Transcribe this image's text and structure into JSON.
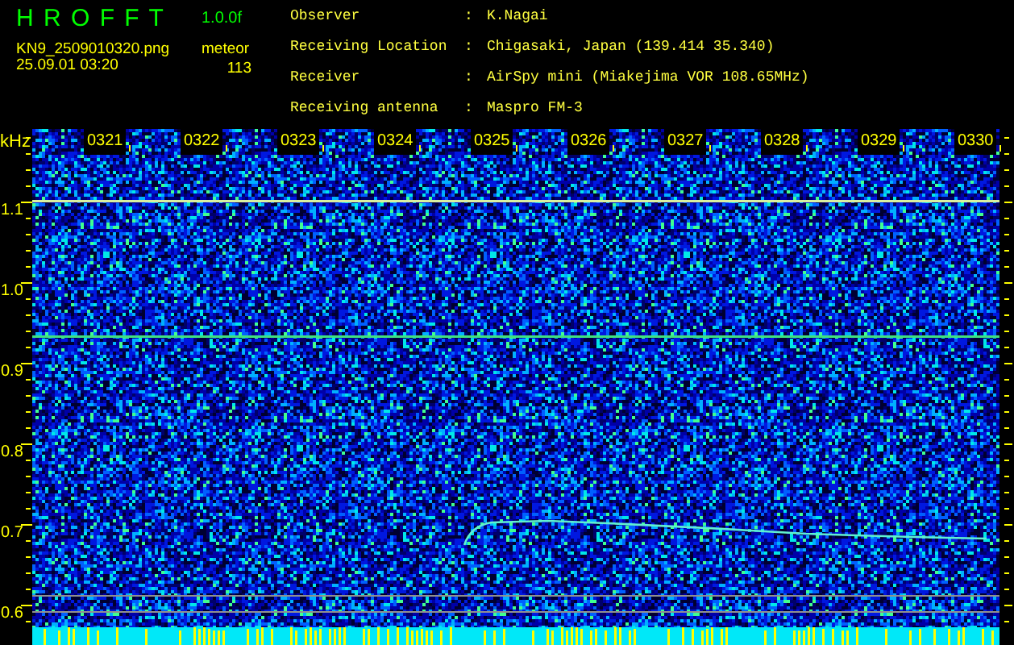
{
  "header": {
    "app_title": "H R O F F T",
    "version": "1.0.0f",
    "file_name": "KN9_2509010320.png",
    "event_label": "meteor",
    "count": "113",
    "timestamp": "25.09.01 03:20"
  },
  "station_info": [
    {
      "label": "Observer",
      "separator": ":",
      "value": "K.Nagai"
    },
    {
      "label": "Receiving Location",
      "separator": ":",
      "value": "Chigasaki, Japan (139.414 35.340)"
    },
    {
      "label": "Receiver",
      "separator": ":",
      "value": "AirSpy mini (Miakejima VOR 108.65MHz)"
    },
    {
      "label": "Receiving antenna",
      "separator": ":",
      "value": "Maspro FM-3"
    }
  ],
  "spectrogram": {
    "unit_label": "kHz",
    "y_labels": [
      "1.1",
      "1.0",
      "0.9",
      "0.8",
      "0.7",
      "0.6"
    ],
    "time_labels": [
      "0321",
      "0322",
      "0323",
      "0324",
      "0325",
      "0326",
      "0327",
      "0328",
      "0329",
      "0330"
    ]
  }
}
